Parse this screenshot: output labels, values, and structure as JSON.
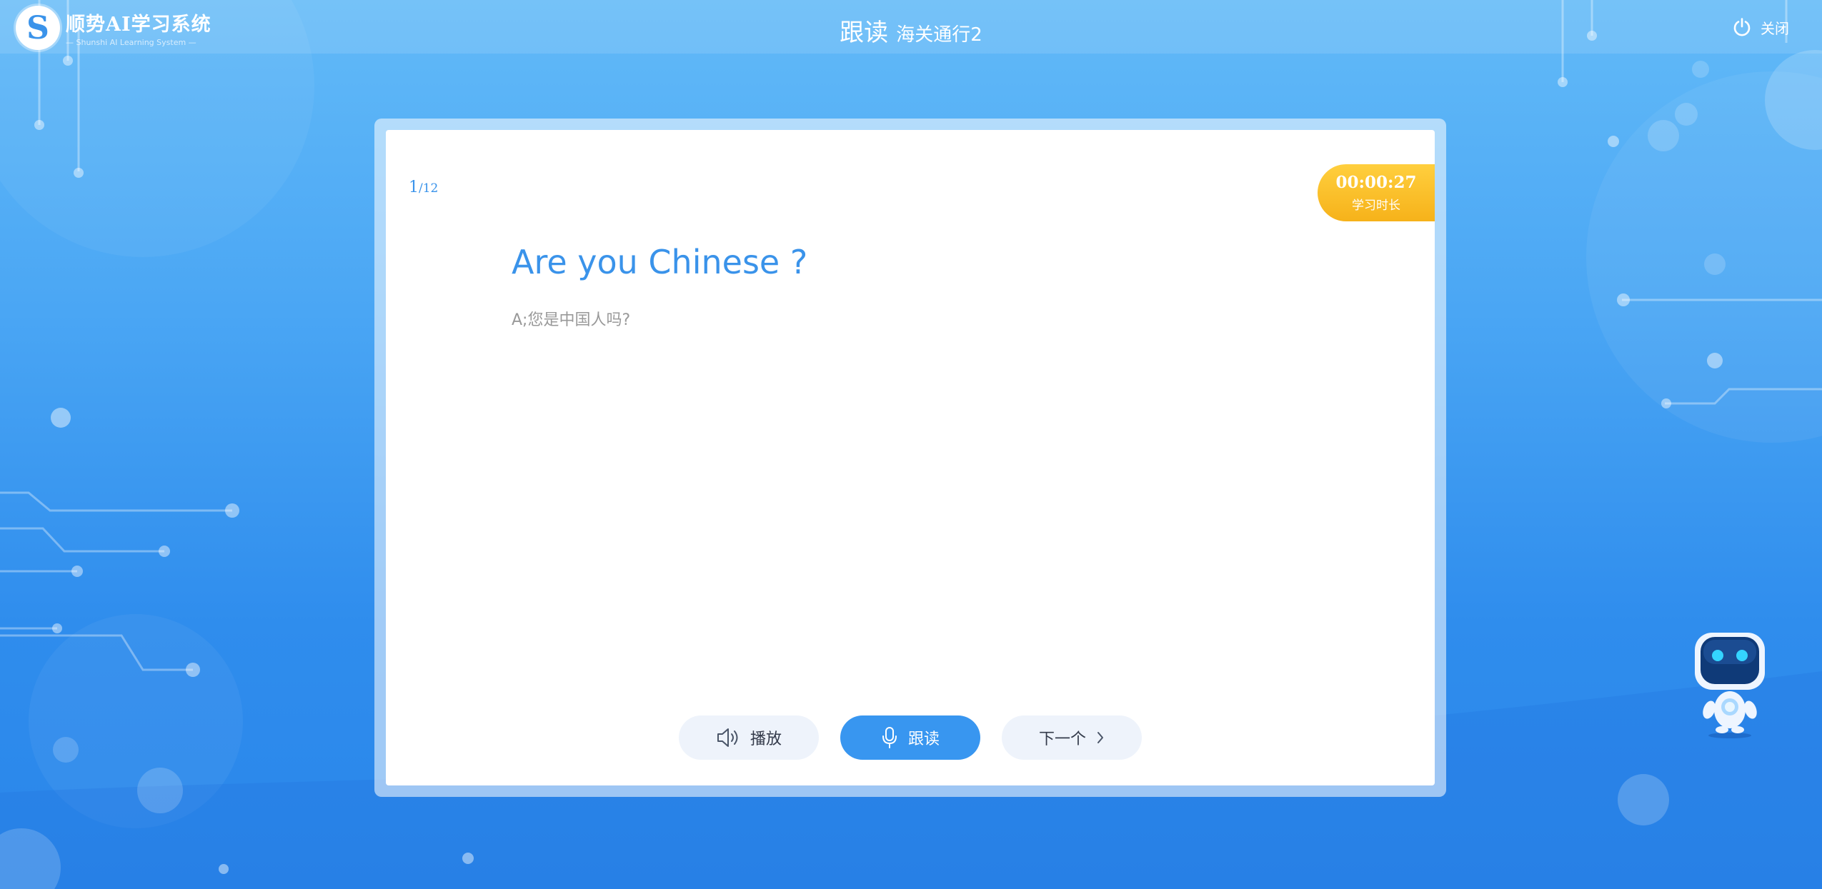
{
  "app": {
    "logo_title": "顺势AI学习系统",
    "logo_subtitle": "— Shunshi AI Learning System —"
  },
  "header": {
    "title_main": "跟读",
    "title_sub": "海关通行2",
    "close_label": "关闭"
  },
  "progress": {
    "current": "1",
    "total": "/12"
  },
  "timer": {
    "value": "00:00:27",
    "label": "学习时长"
  },
  "content": {
    "sentence": "Are you Chinese ?",
    "translation": "A;您是中国人吗?"
  },
  "buttons": {
    "play_label": "播放",
    "read_label": "跟读",
    "next_label": "下一个"
  },
  "colors": {
    "accent": "#3a93ea",
    "primary_button": "#3896f0",
    "timer_badge": "#f6b21a"
  },
  "icons": {
    "close": "power-icon",
    "play": "speaker-icon",
    "read": "microphone-icon",
    "next": "chevron-right-icon"
  }
}
